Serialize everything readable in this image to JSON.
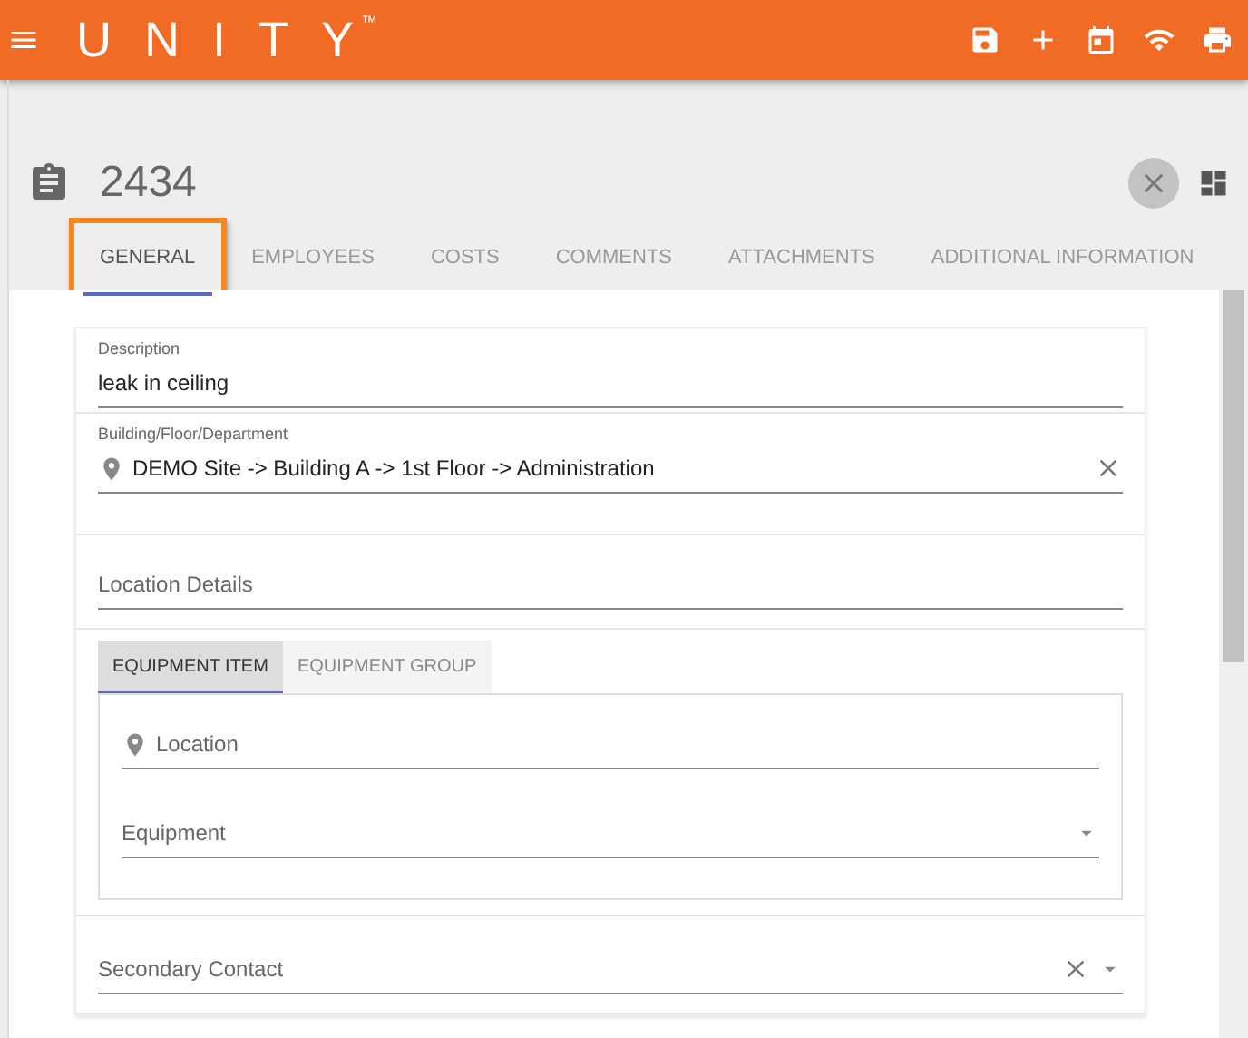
{
  "app": {
    "logo": "UNITY",
    "trademark": "™"
  },
  "record": {
    "number": "2434"
  },
  "tabs": [
    {
      "label": "GENERAL",
      "selected": true,
      "highlighted": true
    },
    {
      "label": "EMPLOYEES",
      "selected": false,
      "highlighted": false
    },
    {
      "label": "COSTS",
      "selected": false,
      "highlighted": false
    },
    {
      "label": "COMMENTS",
      "selected": false,
      "highlighted": false
    },
    {
      "label": "ATTACHMENTS",
      "selected": false,
      "highlighted": false
    },
    {
      "label": "ADDITIONAL INFORMATION",
      "selected": false,
      "highlighted": false
    }
  ],
  "fields": [
    {
      "kind": "text",
      "label": "Description",
      "value": "leak in ceiling"
    },
    {
      "kind": "location",
      "label": "Building/Floor/Department",
      "value": "DEMO Site -> Building A -> 1st Floor -> Administration",
      "clearable": true
    },
    {
      "kind": "text",
      "placeholder": "Location Details"
    }
  ],
  "equipment": {
    "tabs": [
      {
        "label": "EQUIPMENT ITEM",
        "selected": true
      },
      {
        "label": "EQUIPMENT GROUP",
        "selected": false
      }
    ],
    "fields": [
      {
        "kind": "location",
        "placeholder": "Location"
      },
      {
        "kind": "select",
        "placeholder": "Equipment"
      }
    ]
  },
  "contact": {
    "kind": "select",
    "placeholder": "Secondary Contact",
    "clearable": true
  }
}
